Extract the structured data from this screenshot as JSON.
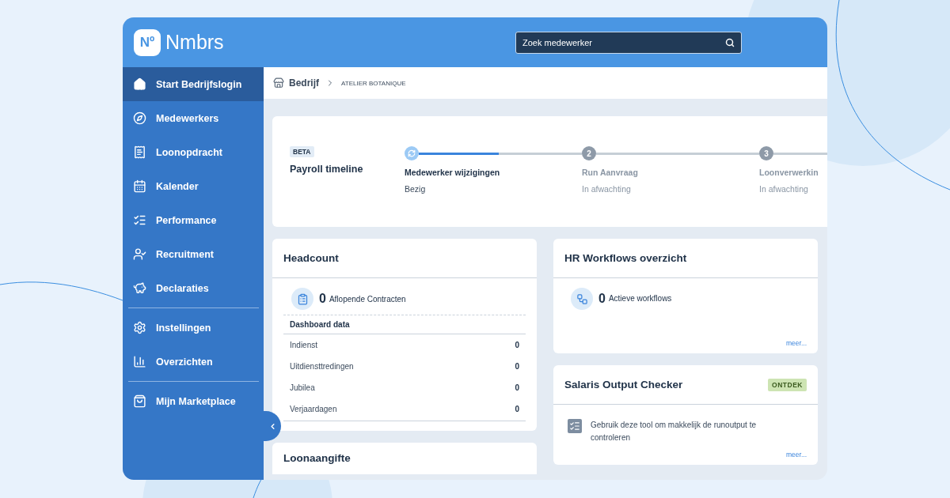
{
  "logo": {
    "badge": "Nº",
    "name": "Nmbrs"
  },
  "search": {
    "placeholder": "Zoek medewerker"
  },
  "sidebar": {
    "groups": [
      {
        "items": [
          {
            "label": "Start Bedrijfslogin",
            "selected": true
          },
          {
            "label": "Medewerkers",
            "selected": false
          },
          {
            "label": "Loonopdracht",
            "selected": false
          },
          {
            "label": "Kalender",
            "selected": false
          },
          {
            "label": "Performance",
            "selected": false
          },
          {
            "label": "Recruitment",
            "selected": false
          },
          {
            "label": "Declaraties",
            "selected": false
          }
        ]
      },
      {
        "items": [
          {
            "label": "Instellingen",
            "selected": false
          },
          {
            "label": "Overzichten",
            "selected": false
          }
        ]
      },
      {
        "items": [
          {
            "label": "Mijn Marketplace",
            "selected": false
          }
        ]
      }
    ]
  },
  "breadcrumb": {
    "section": "Bedrijf",
    "company": "ATELIER BOTANIQUE"
  },
  "timeline": {
    "badge": "BETA",
    "title": "Payroll timeline",
    "level": 0.49,
    "steps": [
      {
        "kind": "active",
        "label": "Medewerker wijzigingen",
        "status": "Bezig"
      },
      {
        "kind": "pending",
        "number": "2",
        "label": "Run Aanvraag",
        "status": "In afwachting"
      },
      {
        "kind": "pending",
        "number": "3",
        "label": "Loonverwerkin",
        "status": "In afwachting"
      }
    ]
  },
  "headcount": {
    "title": "Headcount",
    "stat": {
      "value": "0",
      "label": "Aflopende Contracten"
    },
    "table_title": "Dashboard data",
    "rows": [
      {
        "label": "Indienst",
        "value": "0"
      },
      {
        "label": "Uitdiensttredingen",
        "value": "0"
      },
      {
        "label": "Jubilea",
        "value": "0"
      },
      {
        "label": "Verjaardagen",
        "value": "0"
      }
    ]
  },
  "loonaangifte": {
    "title": "Loonaangifte"
  },
  "workflows": {
    "title": "HR Workflows overzicht",
    "stat": {
      "value": "0",
      "label": "Actieve workflows"
    },
    "link": "meer..."
  },
  "checker": {
    "title": "Salaris Output Checker",
    "badge": "ONTDEK",
    "text": "Gebruik deze tool om makkelijk de runoutput te controleren",
    "link": "meer..."
  }
}
